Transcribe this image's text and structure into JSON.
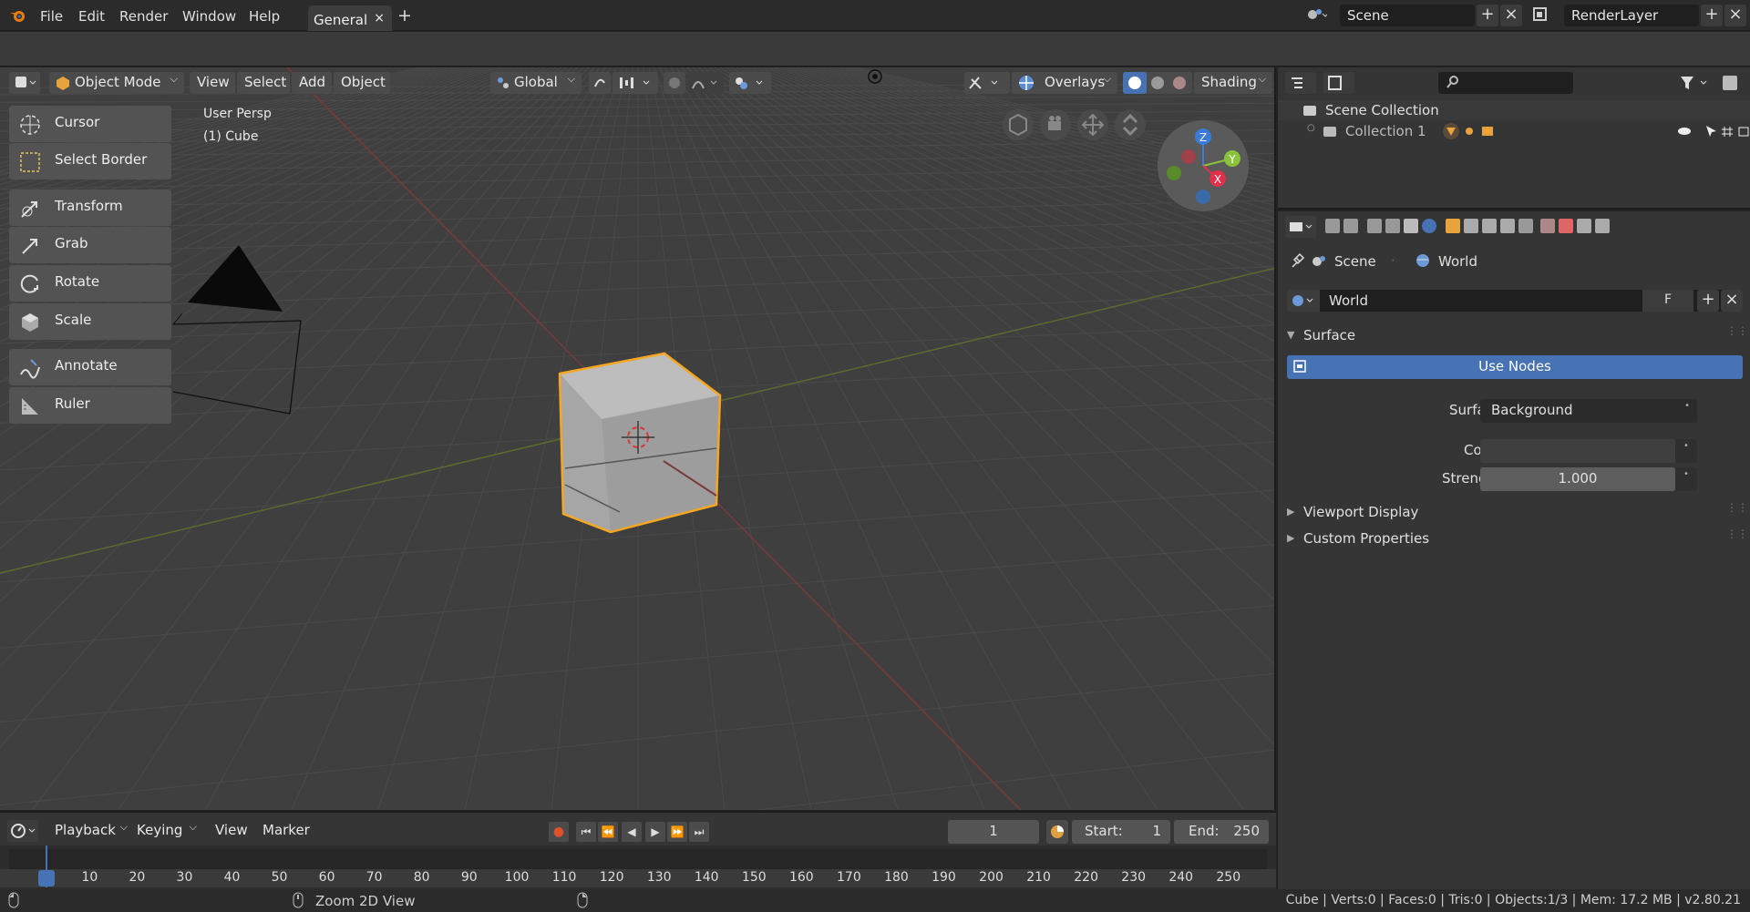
{
  "topbar": {
    "menus": [
      "File",
      "Edit",
      "Render",
      "Window",
      "Help"
    ],
    "workspace_tab": "General",
    "tab_close": "×",
    "add_tab": "+",
    "scene": "Scene",
    "render_layer": "RenderLayer",
    "add": "+",
    "close": "×"
  },
  "viewport": {
    "mode": "Object Mode",
    "menus": [
      "View",
      "Select",
      "Add",
      "Object"
    ],
    "orientation": "Global",
    "overlays": "Overlays",
    "shading": "Shading",
    "persp_label": "User Persp",
    "object_label": "(1) Cube",
    "gizmo": {
      "z": "Z",
      "y": "Y",
      "x": "X"
    },
    "tools": [
      {
        "label": "Cursor",
        "icon": "cursor-icon"
      },
      {
        "label": "Select Border",
        "icon": "select-border-icon"
      },
      {
        "label": "Transform",
        "icon": "transform-icon"
      },
      {
        "label": "Grab",
        "icon": "grab-icon"
      },
      {
        "label": "Rotate",
        "icon": "rotate-icon"
      },
      {
        "label": "Scale",
        "icon": "scale-icon"
      },
      {
        "label": "Annotate",
        "icon": "annotate-icon"
      },
      {
        "label": "Ruler",
        "icon": "ruler-icon"
      }
    ]
  },
  "outliner": {
    "scene_collection": "Scene Collection",
    "collection": "Collection 1"
  },
  "properties": {
    "breadcrumb_scene": "Scene",
    "breadcrumb_world": "World",
    "world_name": "World",
    "fake_user": "F",
    "surface_panel": "Surface",
    "use_nodes": "Use Nodes",
    "surface_label": "Surface",
    "surface_value": "Background",
    "color_label": "Color",
    "strength_label": "Strength",
    "strength_value": "1.000",
    "viewport_display": "Viewport Display",
    "custom_properties": "Custom Properties",
    "colors": {
      "use_nodes_bg": "#4772b3",
      "accent_orange": "#f5a623"
    }
  },
  "timeline": {
    "menus": [
      "Playback",
      "Keying",
      "View",
      "Marker"
    ],
    "current_frame": "1",
    "start_label": "Start:",
    "start_value": "1",
    "end_label": "End:",
    "end_value": "250",
    "ticks": [
      "1",
      "10",
      "20",
      "30",
      "40",
      "50",
      "60",
      "70",
      "80",
      "90",
      "100",
      "110",
      "120",
      "130",
      "140",
      "150",
      "160",
      "170",
      "180",
      "190",
      "200",
      "210",
      "220",
      "230",
      "240",
      "250"
    ]
  },
  "status": {
    "hint": "Zoom 2D View",
    "stats": "Cube | Verts:0 | Faces:0 | Tris:0 | Objects:1/3 | Mem: 17.2 MB | v2.80.21"
  }
}
